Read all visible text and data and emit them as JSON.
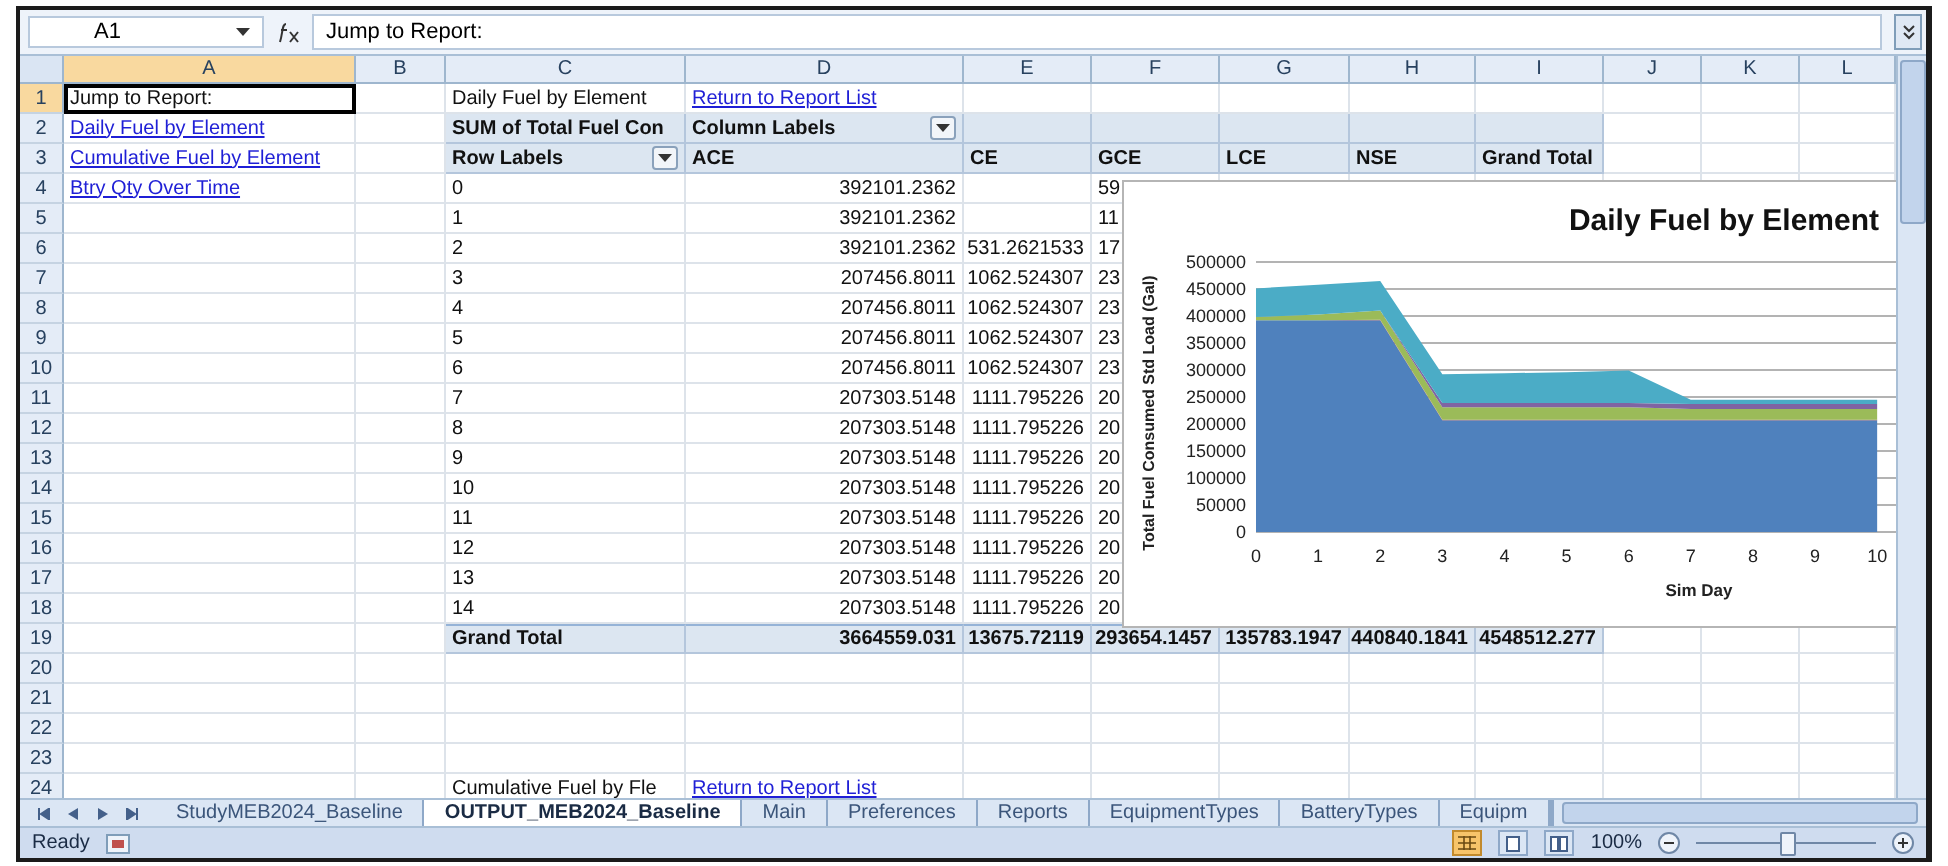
{
  "formula_bar": {
    "name_box": "A1",
    "formula": "Jump to Report:"
  },
  "columns": [
    {
      "label": "A",
      "selected": true
    },
    {
      "label": "B",
      "selected": false
    },
    {
      "label": "C",
      "selected": false
    },
    {
      "label": "D",
      "selected": false
    },
    {
      "label": "E",
      "selected": false
    },
    {
      "label": "F",
      "selected": false
    },
    {
      "label": "G",
      "selected": false
    },
    {
      "label": "H",
      "selected": false
    },
    {
      "label": "I",
      "selected": false
    },
    {
      "label": "J",
      "selected": false
    },
    {
      "label": "K",
      "selected": false
    },
    {
      "label": "L",
      "selected": false
    }
  ],
  "rows": [
    {
      "number": "1",
      "selected": true,
      "shaded": false,
      "cells": [
        {
          "text": "Jump to Report:",
          "kind": "text"
        },
        null,
        {
          "text": "Daily Fuel by Element",
          "kind": "text"
        },
        {
          "text": "Return to Report List",
          "kind": "link"
        }
      ]
    },
    {
      "number": "2",
      "selected": false,
      "shaded": true,
      "cells": [
        {
          "text": "Daily Fuel by Element",
          "kind": "link"
        },
        null,
        {
          "text": "SUM of Total Fuel Con",
          "kind": "header"
        },
        {
          "text": "Column Labels",
          "kind": "header-filter"
        }
      ]
    },
    {
      "number": "3",
      "selected": false,
      "shaded": true,
      "cells": [
        {
          "text": "Cumulative Fuel by Element",
          "kind": "link"
        },
        null,
        {
          "text": "Row Labels",
          "kind": "header-filter"
        },
        {
          "text": "ACE",
          "kind": "header"
        },
        {
          "text": "CE",
          "kind": "header"
        },
        {
          "text": "GCE",
          "kind": "header"
        },
        {
          "text": "LCE",
          "kind": "header"
        },
        {
          "text": "NSE",
          "kind": "header"
        },
        {
          "text": "Grand Total",
          "kind": "header"
        }
      ]
    },
    {
      "number": "4",
      "selected": false,
      "shaded": false,
      "cells": [
        {
          "text": "Btry Qty Over Time",
          "kind": "link"
        },
        null,
        {
          "text": "0",
          "kind": "text"
        },
        {
          "text": "392101.2362",
          "kind": "number"
        },
        null,
        {
          "text": "59",
          "kind": "text"
        }
      ]
    },
    {
      "number": "5",
      "selected": false,
      "shaded": false,
      "cells": [
        null,
        null,
        {
          "text": "1",
          "kind": "text"
        },
        {
          "text": "392101.2362",
          "kind": "number"
        },
        null,
        {
          "text": "11",
          "kind": "text"
        }
      ]
    },
    {
      "number": "6",
      "selected": false,
      "shaded": false,
      "cells": [
        null,
        null,
        {
          "text": "2",
          "kind": "text"
        },
        {
          "text": "392101.2362",
          "kind": "number"
        },
        {
          "text": "531.2621533",
          "kind": "number"
        },
        {
          "text": "17",
          "kind": "text"
        }
      ]
    },
    {
      "number": "7",
      "selected": false,
      "shaded": false,
      "cells": [
        null,
        null,
        {
          "text": "3",
          "kind": "text"
        },
        {
          "text": "207456.8011",
          "kind": "number"
        },
        {
          "text": "1062.524307",
          "kind": "number"
        },
        {
          "text": "23",
          "kind": "text"
        }
      ]
    },
    {
      "number": "8",
      "selected": false,
      "shaded": false,
      "cells": [
        null,
        null,
        {
          "text": "4",
          "kind": "text"
        },
        {
          "text": "207456.8011",
          "kind": "number"
        },
        {
          "text": "1062.524307",
          "kind": "number"
        },
        {
          "text": "23",
          "kind": "text"
        }
      ]
    },
    {
      "number": "9",
      "selected": false,
      "shaded": false,
      "cells": [
        null,
        null,
        {
          "text": "5",
          "kind": "text"
        },
        {
          "text": "207456.8011",
          "kind": "number"
        },
        {
          "text": "1062.524307",
          "kind": "number"
        },
        {
          "text": "23",
          "kind": "text"
        }
      ]
    },
    {
      "number": "10",
      "selected": false,
      "shaded": false,
      "cells": [
        null,
        null,
        {
          "text": "6",
          "kind": "text"
        },
        {
          "text": "207456.8011",
          "kind": "number"
        },
        {
          "text": "1062.524307",
          "kind": "number"
        },
        {
          "text": "23",
          "kind": "text"
        }
      ]
    },
    {
      "number": "11",
      "selected": false,
      "shaded": false,
      "cells": [
        null,
        null,
        {
          "text": "7",
          "kind": "text"
        },
        {
          "text": "207303.5148",
          "kind": "number"
        },
        {
          "text": "1111.795226",
          "kind": "number"
        },
        {
          "text": "20",
          "kind": "text"
        }
      ]
    },
    {
      "number": "12",
      "selected": false,
      "shaded": false,
      "cells": [
        null,
        null,
        {
          "text": "8",
          "kind": "text"
        },
        {
          "text": "207303.5148",
          "kind": "number"
        },
        {
          "text": "1111.795226",
          "kind": "number"
        },
        {
          "text": "20",
          "kind": "text"
        }
      ]
    },
    {
      "number": "13",
      "selected": false,
      "shaded": false,
      "cells": [
        null,
        null,
        {
          "text": "9",
          "kind": "text"
        },
        {
          "text": "207303.5148",
          "kind": "number"
        },
        {
          "text": "1111.795226",
          "kind": "number"
        },
        {
          "text": "20",
          "kind": "text"
        }
      ]
    },
    {
      "number": "14",
      "selected": false,
      "shaded": false,
      "cells": [
        null,
        null,
        {
          "text": "10",
          "kind": "text"
        },
        {
          "text": "207303.5148",
          "kind": "number"
        },
        {
          "text": "1111.795226",
          "kind": "number"
        },
        {
          "text": "20",
          "kind": "text"
        }
      ]
    },
    {
      "number": "15",
      "selected": false,
      "shaded": false,
      "cells": [
        null,
        null,
        {
          "text": "11",
          "kind": "text"
        },
        {
          "text": "207303.5148",
          "kind": "number"
        },
        {
          "text": "1111.795226",
          "kind": "number"
        },
        {
          "text": "20",
          "kind": "text"
        }
      ]
    },
    {
      "number": "16",
      "selected": false,
      "shaded": false,
      "cells": [
        null,
        null,
        {
          "text": "12",
          "kind": "text"
        },
        {
          "text": "207303.5148",
          "kind": "number"
        },
        {
          "text": "1111.795226",
          "kind": "number"
        },
        {
          "text": "20",
          "kind": "text"
        }
      ]
    },
    {
      "number": "17",
      "selected": false,
      "shaded": false,
      "cells": [
        null,
        null,
        {
          "text": "13",
          "kind": "text"
        },
        {
          "text": "207303.5148",
          "kind": "number"
        },
        {
          "text": "1111.795226",
          "kind": "number"
        },
        {
          "text": "20",
          "kind": "text"
        }
      ]
    },
    {
      "number": "18",
      "selected": false,
      "shaded": false,
      "cells": [
        null,
        null,
        {
          "text": "14",
          "kind": "text"
        },
        {
          "text": "207303.5148",
          "kind": "number"
        },
        {
          "text": "1111.795226",
          "kind": "number"
        },
        {
          "text": "20",
          "kind": "text"
        }
      ]
    },
    {
      "number": "19",
      "selected": false,
      "shaded": true,
      "cells": [
        null,
        null,
        {
          "text": "Grand Total",
          "kind": "total"
        },
        {
          "text": "3664559.031",
          "kind": "total-number"
        },
        {
          "text": "13675.72119",
          "kind": "total-number"
        },
        {
          "text": "293654.1457",
          "kind": "total-number"
        },
        {
          "text": "135783.1947",
          "kind": "total-number"
        },
        {
          "text": "440840.1841",
          "kind": "total-number"
        },
        {
          "text": "4548512.277",
          "kind": "total-number"
        }
      ]
    },
    {
      "number": "20",
      "selected": false,
      "shaded": false,
      "cells": []
    },
    {
      "number": "21",
      "selected": false,
      "shaded": false,
      "cells": []
    },
    {
      "number": "22",
      "selected": false,
      "shaded": false,
      "cells": []
    },
    {
      "number": "23",
      "selected": false,
      "shaded": false,
      "cells": []
    },
    {
      "number": "24",
      "selected": false,
      "shaded": false,
      "cells": [
        null,
        null,
        {
          "text": "Cumulative Fuel by Fle",
          "kind": "text"
        },
        {
          "text": "Return to Report List",
          "kind": "link"
        }
      ]
    }
  ],
  "chart": {
    "chart_data": {
      "type": "area",
      "stacked": true,
      "title": "Daily Fuel by Element",
      "xlabel": "Sim Day",
      "ylabel": "Total Fuel Consumed Std Load (Gal)",
      "x": [
        0,
        1,
        2,
        3,
        4,
        5,
        6,
        7,
        8,
        9,
        10
      ],
      "xlim": [
        0,
        10.4
      ],
      "grid": true,
      "ylim": [
        0,
        500000
      ],
      "yticks": [
        0,
        50000,
        100000,
        150000,
        200000,
        250000,
        300000,
        350000,
        400000,
        450000,
        500000
      ],
      "xticks": [
        0,
        1,
        2,
        3,
        4,
        5,
        6,
        7,
        8,
        9,
        10
      ],
      "series": [
        {
          "color": "#4f81bd",
          "values": [
            392000,
            392000,
            392000,
            207000,
            207000,
            207000,
            207000,
            207000,
            207000,
            207000,
            207000
          ]
        },
        {
          "color": "#c0504d",
          "values": [
            0,
            0,
            1000,
            1000,
            1000,
            1000,
            1000,
            1000,
            1000,
            1000,
            1000
          ]
        },
        {
          "color": "#9bbb59",
          "values": [
            6000,
            11000,
            17000,
            23000,
            23000,
            23000,
            23000,
            20000,
            20000,
            20000,
            20000
          ]
        },
        {
          "color": "#8064a2",
          "values": [
            0,
            0,
            0,
            8000,
            8000,
            8000,
            8000,
            9000,
            9000,
            9000,
            9000
          ]
        },
        {
          "color": "#4bacc6",
          "values": [
            53000,
            55000,
            55000,
            53000,
            55000,
            57000,
            60000,
            8000,
            8000,
            8000,
            8000
          ]
        }
      ]
    }
  },
  "sheet_tabs": [
    {
      "label": "StudyMEB2024_Baseline",
      "selected": false
    },
    {
      "label": "OUTPUT_MEB2024_Baseline",
      "selected": true
    },
    {
      "label": "Main",
      "selected": false
    },
    {
      "label": "Preferences",
      "selected": false
    },
    {
      "label": "Reports",
      "selected": false
    },
    {
      "label": "EquipmentTypes",
      "selected": false
    },
    {
      "label": "BatteryTypes",
      "selected": false
    },
    {
      "label": "Equipm",
      "selected": false
    }
  ],
  "status_bar": {
    "status": "Ready",
    "views": [
      {
        "kind": "normal",
        "selected": true
      },
      {
        "kind": "page-layout",
        "selected": false
      },
      {
        "kind": "page-break",
        "selected": false
      }
    ],
    "zoom": "100%",
    "zoom_slider": {
      "level": 0.5
    }
  }
}
